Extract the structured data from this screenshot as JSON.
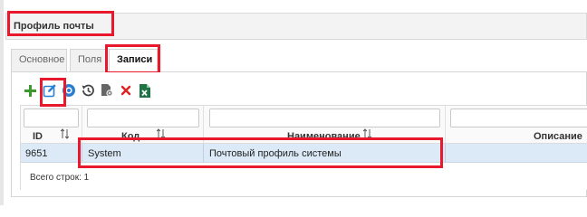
{
  "title": "Профиль почты",
  "tabs": [
    {
      "label": "Основное",
      "active": false
    },
    {
      "label": "Поля",
      "active": false
    },
    {
      "label": "Записи",
      "active": true
    }
  ],
  "toolbar": [
    {
      "icon": "plus-icon",
      "color": "#3a9a2b"
    },
    {
      "icon": "edit-icon",
      "color": "#2b7fd1"
    },
    {
      "icon": "eye-icon",
      "color": "#2b7fd1"
    },
    {
      "icon": "history-icon",
      "color": "#444444"
    },
    {
      "icon": "file-gear-icon",
      "color": "#555555"
    },
    {
      "icon": "close-icon",
      "color": "#e02020"
    },
    {
      "icon": "excel-icon",
      "color": "#217346"
    }
  ],
  "grid": {
    "columns": [
      {
        "label": "ID"
      },
      {
        "label": "Код"
      },
      {
        "label": "Наименование"
      },
      {
        "label": "Описание"
      }
    ],
    "rows": [
      {
        "id": "9651",
        "code": "System",
        "name": "Почтовый профиль системы",
        "description": ""
      }
    ],
    "footer": "Всего строк: 1"
  },
  "colors": {
    "highlight": "#e8192c",
    "selected_row": "#dce9f6",
    "title_bar": "#f3f3f3"
  }
}
